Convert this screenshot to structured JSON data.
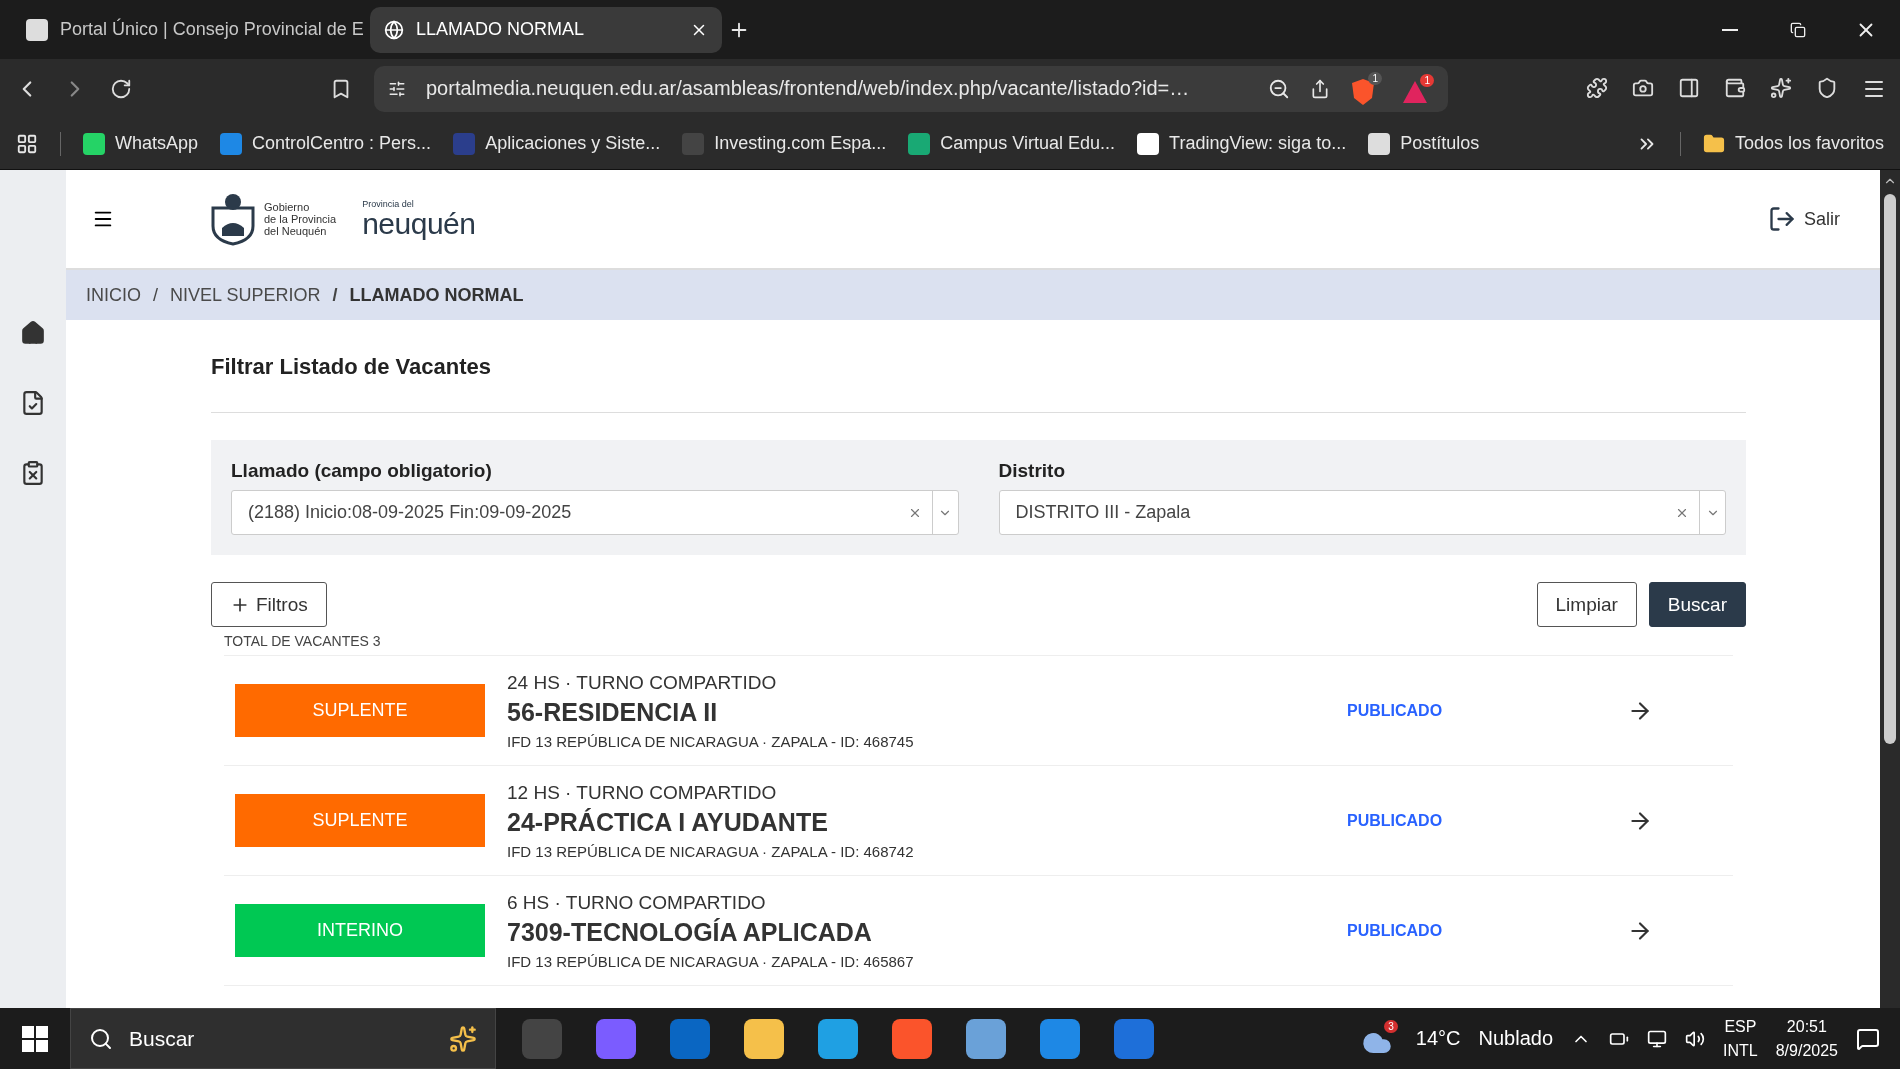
{
  "browser": {
    "tabs": [
      {
        "title": "Portal Único | Consejo Provincial de E",
        "selected": false
      },
      {
        "title": "LLAMADO NORMAL",
        "selected": true
      }
    ],
    "address": "portalmedia.neuquen.edu.ar/asambleas/frontend/web/index.php/vacante/listado?id=…",
    "extension_badges": [
      "1",
      "1"
    ],
    "bookmarks": [
      {
        "label": "WhatsApp",
        "color": "#25d366"
      },
      {
        "label": "ControlCentro : Pers...",
        "color": "#1e88e5"
      },
      {
        "label": "Aplicaciones y Siste...",
        "color": "#2b3e8c"
      },
      {
        "label": "Investing.com Espa...",
        "color": "#444444"
      },
      {
        "label": "Campus Virtual Edu...",
        "color": "#19a974"
      },
      {
        "label": "TradingView: siga to...",
        "color": "#ffffff"
      },
      {
        "label": "Postítulos",
        "color": "#dddddd"
      }
    ],
    "all_bookmarks": "Todos los favoritos"
  },
  "header": {
    "logo_lines": [
      "Gobierno",
      "de la Provincia",
      "del Neuquén"
    ],
    "brand_small": "Provincia del",
    "brand": "neuquén",
    "logout": "Salir"
  },
  "breadcrumb": [
    {
      "label": "INICIO",
      "current": false
    },
    {
      "separator": "/",
      "label": "NIVEL SUPERIOR",
      "current": false
    },
    {
      "separator": "/",
      "label": "LLAMADO NORMAL",
      "current": true
    }
  ],
  "filter": {
    "title": "Filtrar Listado de Vacantes",
    "fields": [
      {
        "label": "Llamado (campo obligatorio)",
        "value": "(2188) Inicio:08-09-2025 Fin:09-09-2025"
      },
      {
        "label": "Distrito",
        "value": "DISTRITO III - Zapala"
      }
    ],
    "more_button": "Filtros",
    "clear_button": "Limpiar",
    "search_button": "Buscar"
  },
  "total": "TOTAL DE VACANTES 3",
  "vacancies": [
    {
      "type": "SUPLENTE",
      "color": "#ff6a00",
      "hours": "24 HS · TURNO COMPARTIDO",
      "title": "56-RESIDENCIA II",
      "detail": "IFD 13 REPÚBLICA DE NICARAGUA · ZAPALA - ID: 468745",
      "status": "PUBLICADO"
    },
    {
      "type": "SUPLENTE",
      "color": "#ff6a00",
      "hours": "12 HS · TURNO COMPARTIDO",
      "title": "24-PRÁCTICA I AYUDANTE",
      "detail": "IFD 13 REPÚBLICA DE NICARAGUA · ZAPALA - ID: 468742",
      "status": "PUBLICADO"
    },
    {
      "type": "INTERINO",
      "color": "#00c853",
      "hours": "6 HS · TURNO COMPARTIDO",
      "title": "7309-TECNOLOGÍA APLICADA",
      "detail": "IFD 13 REPÚBLICA DE NICARAGUA · ZAPALA - ID: 465867",
      "status": "PUBLICADO"
    }
  ],
  "taskbar": {
    "search": "Buscar",
    "weather_badge": "3",
    "temperature": "14°C",
    "weather": "Nublado",
    "language": "ESP",
    "layout": "INTL",
    "time": "20:51",
    "date": "8/9/2025"
  }
}
